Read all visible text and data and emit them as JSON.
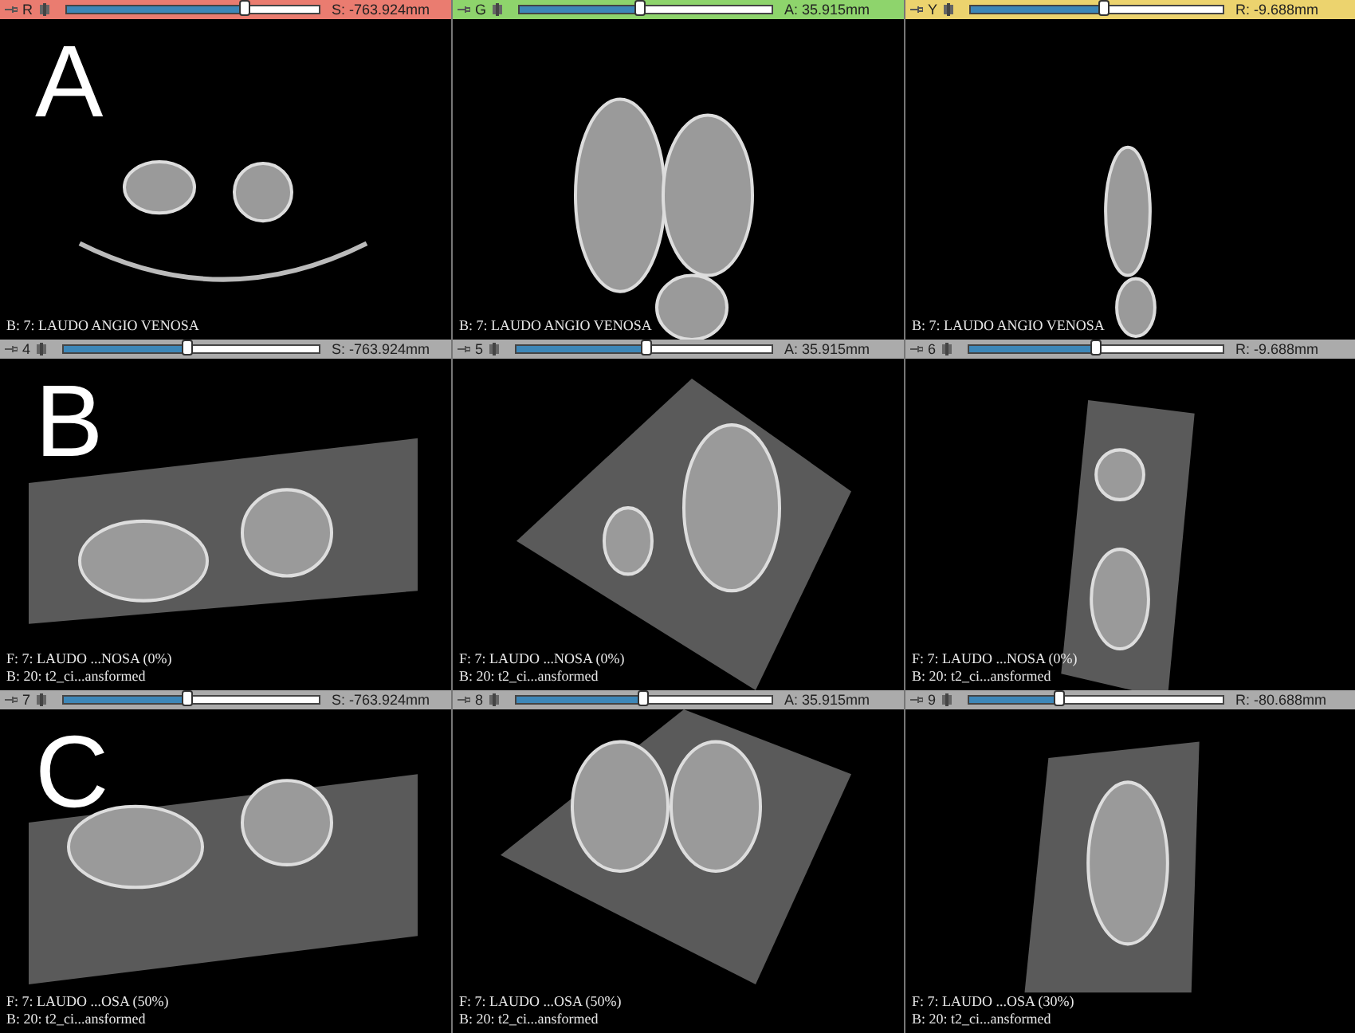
{
  "views": [
    {
      "label": "R",
      "color": "#ea7c70",
      "level": 0.71,
      "reading": "S: -763.924mm",
      "letter": "A",
      "overlay": [
        "B: 7: LAUDO ANGIO VENOSA"
      ]
    },
    {
      "label": "G",
      "color": "#8ed46c",
      "level": 0.48,
      "reading": "A: 35.915mm",
      "overlay": [
        "B: 7: LAUDO ANGIO VENOSA"
      ]
    },
    {
      "label": "Y",
      "color": "#ecd36e",
      "level": 0.53,
      "reading": "R: -9.688mm",
      "overlay": [
        "B: 7: LAUDO ANGIO VENOSA"
      ]
    },
    {
      "label": "4",
      "color": "#ababab",
      "level": 0.49,
      "reading": "S: -763.924mm",
      "letter": "B",
      "overlay": [
        "F: 7: LAUDO ...NOSA (0%)",
        "B: 20: t2_ci...ansformed"
      ]
    },
    {
      "label": "5",
      "color": "#ababab",
      "level": 0.51,
      "reading": "A: 35.915mm",
      "overlay": [
        "F: 7: LAUDO ...NOSA (0%)",
        "B: 20: t2_ci...ansformed"
      ]
    },
    {
      "label": "6",
      "color": "#ababab",
      "level": 0.5,
      "reading": "R: -9.688mm",
      "overlay": [
        "F: 7: LAUDO ...NOSA (0%)",
        "B: 20: t2_ci...ansformed"
      ]
    },
    {
      "label": "7",
      "color": "#ababab",
      "level": 0.49,
      "reading": "S: -763.924mm",
      "letter": "C",
      "overlay": [
        "F: 7: LAUDO ...OSA (50%)",
        "B: 20: t2_ci...ansformed"
      ]
    },
    {
      "label": "8",
      "color": "#ababab",
      "level": 0.5,
      "reading": "A: 35.915mm",
      "overlay": [
        "F: 7: LAUDO ...OSA (50%)",
        "B: 20: t2_ci...ansformed"
      ]
    },
    {
      "label": "9",
      "color": "#ababab",
      "level": 0.36,
      "reading": "R: -80.688mm",
      "overlay": [
        "F: 7: LAUDO ...OSA (30%)",
        "B: 20: t2_ci...ansformed"
      ]
    }
  ]
}
